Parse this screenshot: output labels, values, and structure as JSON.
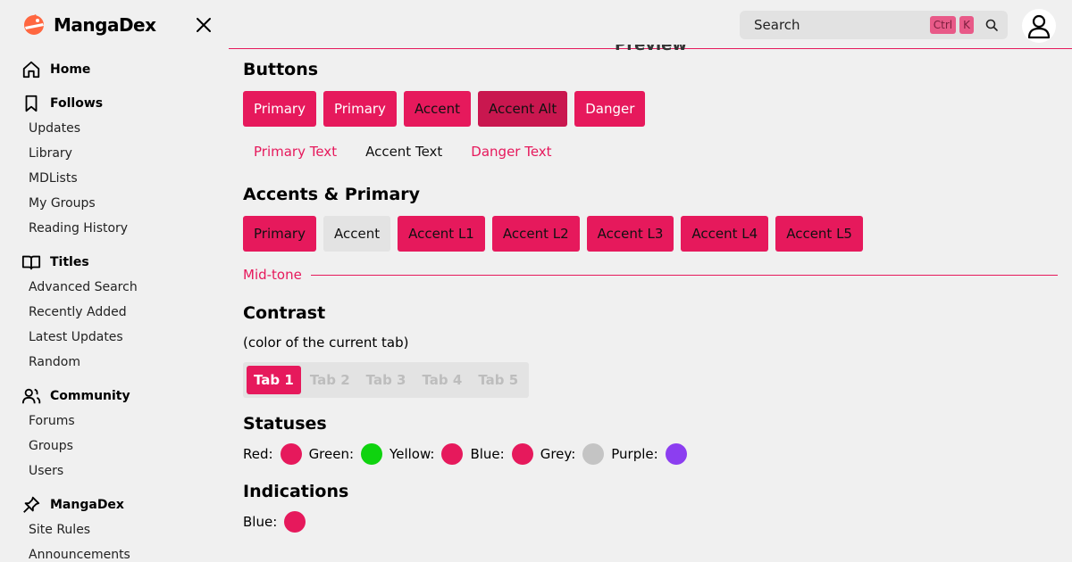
{
  "brand": {
    "name": "MangaDex"
  },
  "nav": {
    "home": "Home",
    "follows": {
      "label": "Follows",
      "items": [
        "Updates",
        "Library",
        "MDLists",
        "My Groups",
        "Reading History"
      ]
    },
    "titles": {
      "label": "Titles",
      "items": [
        "Advanced Search",
        "Recently Added",
        "Latest Updates",
        "Random"
      ]
    },
    "community": {
      "label": "Community",
      "items": [
        "Forums",
        "Groups",
        "Users"
      ]
    },
    "mangadex": {
      "label": "MangaDex",
      "items": [
        "Site Rules",
        "Announcements"
      ]
    }
  },
  "header": {
    "search_placeholder": "Search",
    "kbd_ctrl": "Ctrl",
    "kbd_k": "K"
  },
  "preview_label": "Preview",
  "buttons": {
    "title": "Buttons",
    "filled": [
      "Primary",
      "Primary",
      "Accent",
      "Accent Alt",
      "Danger"
    ],
    "text": [
      "Primary Text",
      "Accent Text",
      "Danger Text"
    ]
  },
  "accents": {
    "title": "Accents & Primary",
    "items": [
      "Primary",
      "Accent",
      "Accent L1",
      "Accent L2",
      "Accent L3",
      "Accent L4",
      "Accent L5"
    ]
  },
  "midtone": "Mid-tone",
  "contrast": {
    "title": "Contrast",
    "note": "(color of the current tab)",
    "tabs": [
      "Tab 1",
      "Tab 2",
      "Tab 3",
      "Tab 4",
      "Tab 5"
    ]
  },
  "statuses": {
    "title": "Statuses",
    "items": [
      {
        "label": "Red:",
        "color": "#e6195c"
      },
      {
        "label": "Green:",
        "color": "#0fd30f"
      },
      {
        "label": "Yellow:",
        "color": "#e6195c"
      },
      {
        "label": "Blue:",
        "color": "#e6195c"
      },
      {
        "label": "Grey:",
        "color": "#c4c4c4"
      },
      {
        "label": "Purple:",
        "color": "#8c3ef0"
      }
    ]
  },
  "indications": {
    "title": "Indications",
    "items": [
      {
        "label": "Blue:",
        "color": "#e6195c"
      }
    ]
  },
  "colors": {
    "primary": "#e6195c",
    "accent_alt": "#c9174f",
    "background": "#f0f0f0"
  }
}
